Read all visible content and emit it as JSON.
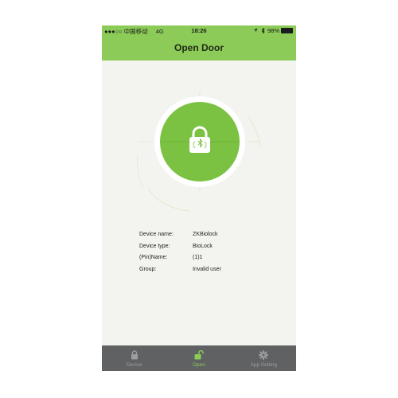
{
  "status_bar": {
    "signal": "●●●○○",
    "carrier": "中国移动",
    "network": "4G",
    "time": "18:26",
    "location_icon": "location-arrow-icon",
    "bluetooth_icon": "bluetooth-icon",
    "battery_percent": "98%",
    "battery_level": 0.98
  },
  "header": {
    "title": "Open Door"
  },
  "lock_button": {
    "icon": "padlock-bluetooth-icon",
    "accent": "#7cc242"
  },
  "device_info": {
    "rows": [
      {
        "label": "Device name:",
        "value": "ZKBiolock"
      },
      {
        "label": "Device type:",
        "value": "BioLock"
      },
      {
        "label": "(Pin)Name:",
        "value": "(1)1"
      },
      {
        "label": "Group:",
        "value": "Invalid user"
      }
    ]
  },
  "tabbar": {
    "tabs": [
      {
        "label": "Device",
        "icon": "lock-icon",
        "active": false
      },
      {
        "label": "Open",
        "icon": "unlock-icon",
        "active": true
      },
      {
        "label": "App Setting",
        "icon": "gear-icon",
        "active": false
      }
    ]
  },
  "colors": {
    "accent": "#8ccb58",
    "tabbar_bg": "#5f6163",
    "background": "#f3f4ef"
  }
}
